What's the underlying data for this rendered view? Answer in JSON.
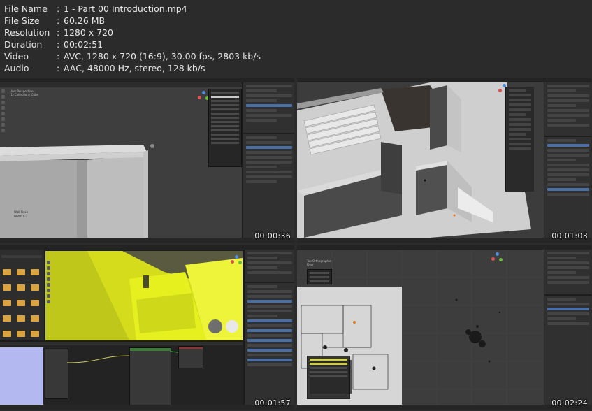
{
  "file_info": [
    {
      "key": "File Name",
      "value": "1 - Part 00 Introduction.mp4"
    },
    {
      "key": "File Size",
      "value": "60.26 MB"
    },
    {
      "key": "Resolution",
      "value": "1280 x 720"
    },
    {
      "key": "Duration",
      "value": "00:02:51"
    },
    {
      "key": "Video",
      "value": "AVC, 1280 x 720 (16:9), 30.00 fps, 2803 kb/s"
    },
    {
      "key": "Audio",
      "value": "AAC, 48000 Hz, stereo, 128 kb/s"
    }
  ],
  "separator": ":",
  "thumbnails": [
    {
      "timestamp": "00:00:36"
    },
    {
      "timestamp": "00:01:03"
    },
    {
      "timestamp": "00:01:57"
    },
    {
      "timestamp": "00:02:24"
    }
  ],
  "colors": {
    "background": "#2b2b2b",
    "text": "#e6e6e6",
    "selection_blue": "#4a6fa5",
    "viewport_grey": "#3d3d3d",
    "light_surface": "#c8c8c8",
    "yellow_highlight": "#e6f01e",
    "material_lavender": "#b4b8f0",
    "orange_marker": "#e07a1e"
  }
}
